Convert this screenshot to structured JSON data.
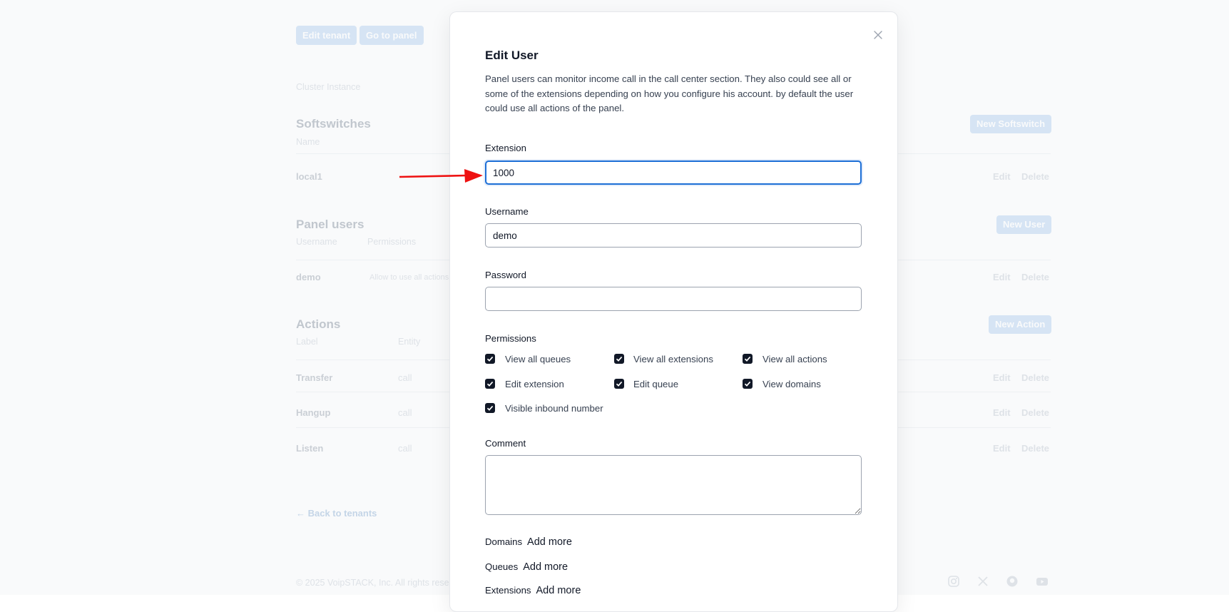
{
  "background": {
    "header_buttons": {
      "edit_tenant": "Edit tenant",
      "go_to_panel": "Go to panel"
    },
    "cluster_instance": "Cluster Instance",
    "softswitches": {
      "title": "Softswitches",
      "new_button": "New Softswitch",
      "columns": [
        "Name"
      ],
      "rows": [
        {
          "name": "local1",
          "edit": "Edit",
          "delete": "Delete"
        }
      ]
    },
    "panel_users": {
      "title": "Panel users",
      "new_button": "New User",
      "columns": [
        "Username",
        "Permissions"
      ],
      "rows": [
        {
          "name": "demo",
          "permissions": "Allow to use all actions",
          "edit": "Edit",
          "delete": "Delete"
        }
      ]
    },
    "actions": {
      "title": "Actions",
      "new_button": "New Action",
      "columns": [
        "Label",
        "Entity"
      ],
      "rows": [
        {
          "label": "Transfer",
          "entity": "call",
          "edit": "Edit",
          "delete": "Delete"
        },
        {
          "label": "Hangup",
          "entity": "call",
          "edit": "Edit",
          "delete": "Delete"
        },
        {
          "label": "Listen",
          "entity": "call",
          "edit": "Edit",
          "delete": "Delete"
        }
      ]
    },
    "back_link": "← Back to tenants",
    "footer": {
      "copyright": "© 2025 VoipSTACK, Inc. All rights rese",
      "icons": [
        "instagram-icon",
        "x-icon",
        "github-icon",
        "youtube-icon"
      ]
    }
  },
  "modal": {
    "title": "Edit User",
    "description": "Panel users can monitor income call in the call center section. They also could see all or some of the extensions depending on how you configure his account. by default the user could use all actions of the panel.",
    "extension": {
      "label": "Extension",
      "value": "1000"
    },
    "username": {
      "label": "Username",
      "value": "demo"
    },
    "password": {
      "label": "Password",
      "value": ""
    },
    "permissions": {
      "label": "Permissions",
      "items": [
        {
          "label": "View all queues",
          "checked": true
        },
        {
          "label": "View all extensions",
          "checked": true
        },
        {
          "label": "View all actions",
          "checked": true
        },
        {
          "label": "Edit extension",
          "checked": true
        },
        {
          "label": "Edit queue",
          "checked": true
        },
        {
          "label": "View domains",
          "checked": true
        },
        {
          "label": "Visible inbound number",
          "checked": true
        }
      ]
    },
    "comment": {
      "label": "Comment",
      "value": ""
    },
    "lists": [
      {
        "label": "Domains",
        "action": "Add more"
      },
      {
        "label": "Queues",
        "action": "Add more"
      },
      {
        "label": "Extensions",
        "action": "Add more"
      }
    ]
  },
  "annotation": {
    "arrow_color": "#ee1111"
  }
}
